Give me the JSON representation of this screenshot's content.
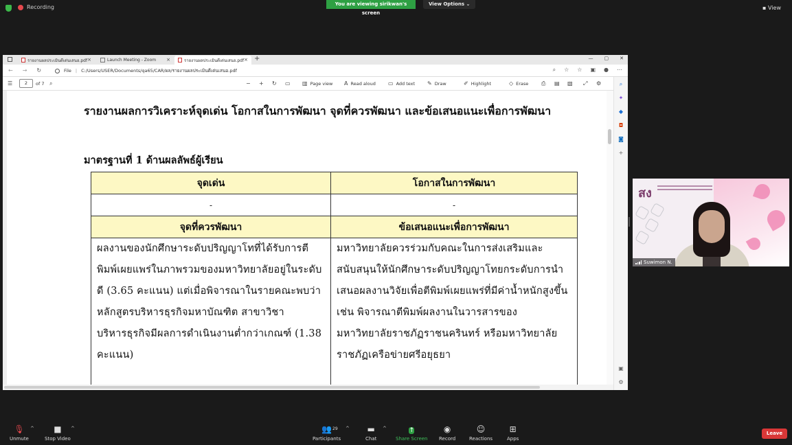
{
  "zoom": {
    "recording_label": "Recording",
    "viewing_banner": "You are viewing sirikwan's screen",
    "view_options": "View Options",
    "view_options_caret": "⌄",
    "view_label": "View",
    "video_name": "Suwimon N.",
    "participants_count": "29",
    "toolbar": {
      "unmute": "Unmute",
      "stop_video": "Stop Video",
      "participants": "Participants",
      "chat": "Chat",
      "share_screen": "Share Screen",
      "record": "Record",
      "reactions": "Reactions",
      "apps": "Apps",
      "leave": "Leave"
    }
  },
  "browser": {
    "tabs": [
      {
        "label": "รายงานผลประเมินดีเด่นเสนอ.pdf"
      },
      {
        "label": "Launch Meeting - Zoom"
      },
      {
        "label": "รายงานผลประเมินดีเด่นเสนอ.pdf"
      }
    ],
    "tab_close": "×",
    "new_tab": "+",
    "win_min": "—",
    "win_max": "▢",
    "win_close": "✕",
    "url_file_label": "File",
    "url_path": "C:/Users/USER/Documents/qa65/CAR/ผล/รายงานผลประเมินดีเด่นเสนอ.pdf"
  },
  "pdf_toolbar": {
    "page_number": "2",
    "page_total": "of 7",
    "page_view": "Page view",
    "read_aloud": "Read aloud",
    "add_text": "Add text",
    "draw": "Draw",
    "highlight": "Highlight",
    "erase": "Erase"
  },
  "document": {
    "title": "รายงานผลการวิเคราะห์จุดเด่น  โอกาสในการพัฒนา  จุดที่ควรพัฒนา  และข้อเสนอแนะเพื่อการพัฒนา",
    "standard_heading": "มาตรฐานที่ 1 ด้านผลลัพธ์ผู้เรียน",
    "table": {
      "header_strengths": "จุดเด่น",
      "header_opportunities": "โอกาสในการพัฒนา",
      "strengths_value": "-",
      "opportunities_value": "-",
      "header_improve": "จุดที่ควรพัฒนา",
      "header_suggestions": "ข้อเสนอแนะเพื่อการพัฒนา",
      "improve_text": "ผลงานของนักศึกษาระดับปริญญาโทที่ได้รับการตีพิมพ์เผยแพร่ในภาพรวมของมหาวิทยาลัยอยู่ในระดับดี (3.65 คะแนน) แต่เมื่อพิจารณาในรายคณะพบว่า หลักสูตรบริหารธุรกิจมหาบัณฑิต สาขาวิชาบริหารธุรกิจมีผลการดำเนินงานต่ำกว่าเกณฑ์ (1.38 คะแนน)",
      "suggestion_text": "มหาวิทยาลัยควรร่วมกับคณะในการส่งเสริมและสนับสนุนให้นักศึกษาระดับปริญญาโทยกระดับการนำเสนอผลงานวิจัยเพื่อตีพิมพ์เผยแพร่ที่มีค่าน้ำหนักสูงขึ้น เช่น พิจารณาตีพิมพ์ผลงานในวารสารของมหาวิทยาลัยราชภัฏราชนครินทร์ หรือมหาวิทยาลัยราชภัฏเครือข่ายศรีอยุธยา"
    }
  },
  "colors": {
    "zoom_bg": "#1a1a1a",
    "banner_green": "#2ea043",
    "table_header_yellow": "#fdf8c4",
    "leave_red": "#d93737",
    "record_red": "#e5484d"
  }
}
